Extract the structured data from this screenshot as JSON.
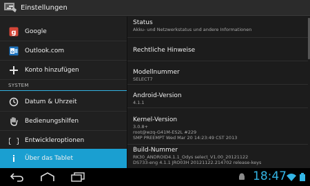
{
  "app": {
    "title": "Einstellungen"
  },
  "sidebar": {
    "items": [
      {
        "label": "Google",
        "icon": "google-icon"
      },
      {
        "label": "Outlook.com",
        "icon": "outlook-icon"
      },
      {
        "label": "Konto hinzufügen",
        "icon": "plus-icon"
      }
    ],
    "section_header": "SYSTEM",
    "system_items": [
      {
        "label": "Datum & Uhrzeit",
        "icon": "clock-icon"
      },
      {
        "label": "Bedienungshilfen",
        "icon": "hand-icon"
      },
      {
        "label": "Entwickleroptionen",
        "icon": "braces-icon"
      },
      {
        "label": "Über das Tablet",
        "icon": "info-icon",
        "selected": true
      }
    ]
  },
  "content": {
    "status": {
      "title": "Status",
      "summary": "Akku- und Netzwerkstatus und andere Informationen"
    },
    "legal": {
      "title": "Rechtliche Hinweise"
    },
    "model": {
      "title": "Modellnummer",
      "value": "SELECT7"
    },
    "android": {
      "title": "Android-Version",
      "value": "4.1.1"
    },
    "kernel": {
      "title": "Kernel-Version",
      "line1": "3.0.8+",
      "line2": "root@wzq-G41M-ES2L #229",
      "line3": "SMP PREEMPT Wed Mar 20 14:23:49 CST 2013"
    },
    "build": {
      "title": "Build-Nummer",
      "line1": "RK30_ANDROID4.1.1_Odys select_V1.00_20121122",
      "line2": "DS733-eng 4.1.1 JRO03H 20121122.214702 release-keys"
    }
  },
  "navbar": {
    "time": "18:47",
    "accent": "#33b5e5"
  },
  "colors": {
    "selected": "#1a9fd1",
    "background": "#1c1c1c"
  }
}
